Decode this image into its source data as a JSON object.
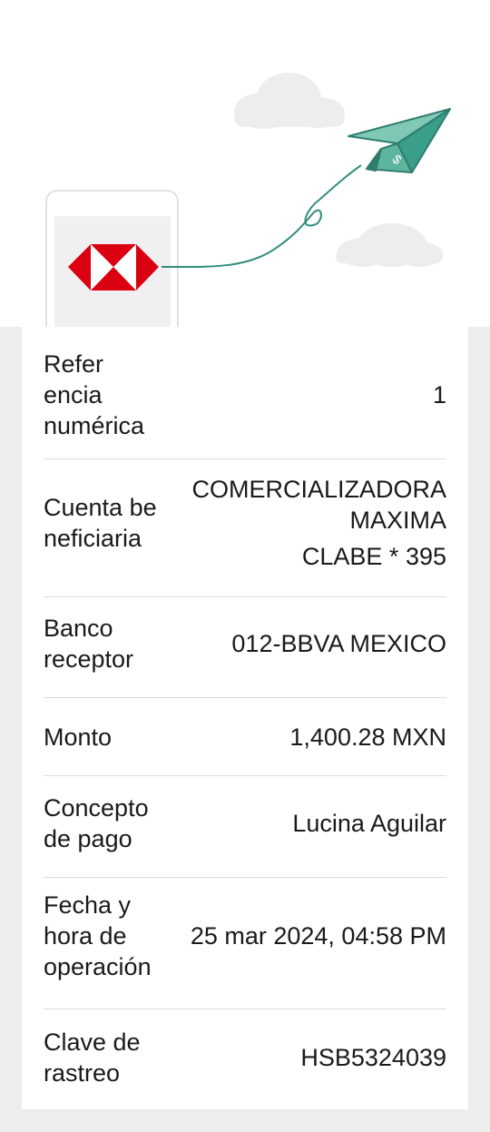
{
  "bank": {
    "logo_icon": "hsbc-hexagon-logo-icon",
    "logo_colors": {
      "red": "#db0011",
      "white": "#ffffff"
    }
  },
  "illustration": {
    "plane_icon": "paper-airplane-money-icon",
    "plane_color": "#3a9e8a",
    "plane_glyph": "$"
  },
  "details": [
    {
      "key": "referencia",
      "label_lines": [
        "Refer",
        "encia",
        "numérica"
      ],
      "value_lines": [
        "1"
      ]
    },
    {
      "key": "cuenta",
      "label_lines": [
        "Cuenta be",
        "neficiaria"
      ],
      "value_lines": [
        "COMERCIALIZADORA",
        "MAXIMA",
        "CLABE * 395"
      ]
    },
    {
      "key": "banco",
      "label_lines": [
        "Banco",
        "receptor"
      ],
      "value_lines": [
        "012-BBVA MEXICO"
      ]
    },
    {
      "key": "monto",
      "label_lines": [
        "Monto"
      ],
      "value_lines": [
        "1,400.28 MXN"
      ]
    },
    {
      "key": "concepto",
      "label_lines": [
        "Concepto",
        "de pago"
      ],
      "value_lines": [
        "Lucina Aguilar"
      ]
    },
    {
      "key": "fecha",
      "label_lines": [
        "Fecha y",
        "hora de",
        "operación"
      ],
      "value_lines": [
        "25 mar 2024, 04:58 PM"
      ]
    },
    {
      "key": "clave",
      "label_lines": [
        "Clave de",
        "rastreo"
      ],
      "value_lines": [
        "HSB5324039"
      ]
    }
  ]
}
